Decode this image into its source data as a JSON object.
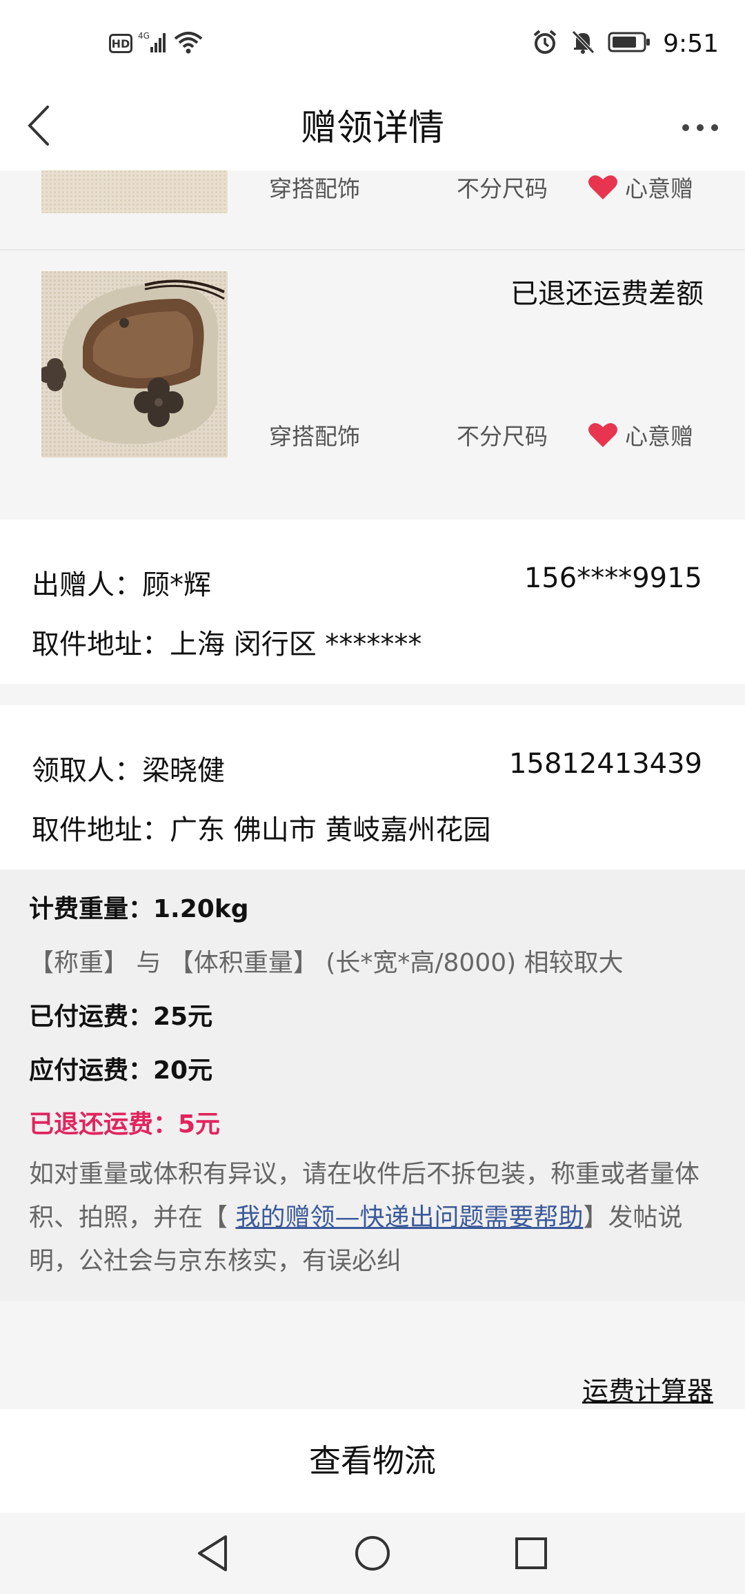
{
  "status_bar": {
    "network": "4G",
    "hd": "HD",
    "time": "9:51"
  },
  "header": {
    "title": "赠领详情"
  },
  "items": [
    {
      "category": "穿搭配饰",
      "size": "不分尺码",
      "tag": "心意赠"
    },
    {
      "status": "已退还运费差额",
      "category": "穿搭配饰",
      "size": "不分尺码",
      "tag": "心意赠"
    }
  ],
  "sender": {
    "label": "出赠人：",
    "name": "顾*辉",
    "phone": "156****9915",
    "address_label": "取件地址：",
    "address": "上海 闵行区 *******"
  },
  "receiver": {
    "label": "领取人：",
    "name": "梁晓健",
    "phone": "15812413439",
    "address_label": "取件地址：",
    "address": "广东 佛山市 黄岐嘉州花园"
  },
  "shipping": {
    "weight": "计费重量：1.20kg",
    "rule": "【称重】 与 【体积重量】 (长*宽*高/8000) 相较取大",
    "paid": "已付运费：25元",
    "due": "应付运费：20元",
    "refunded": "已退还运费：5元",
    "note_before": "如对重量或体积有异议，请在收件后不拆包装，称重或者量体积、拍照，并在【 ",
    "note_link": "我的赠领—快递出问题需要帮助",
    "note_after": "】发帖说明，公社会与京东核实，有误必纠"
  },
  "calculator_link": "运费计算器",
  "logistics_button": "查看物流",
  "colors": {
    "heart": "#e8354f",
    "refund_red": "#e0245e",
    "link_blue": "#3b5a9a"
  }
}
